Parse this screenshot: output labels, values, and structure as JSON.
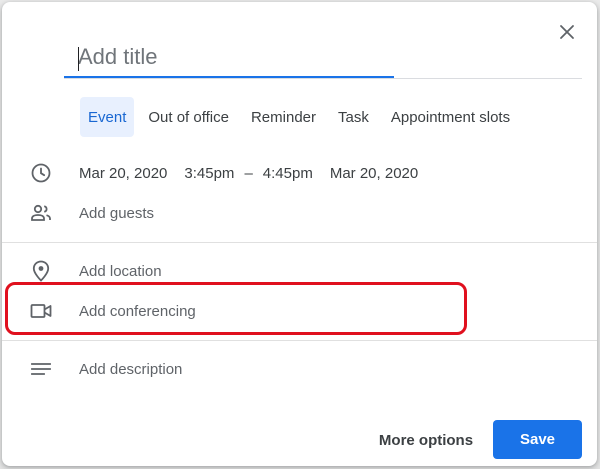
{
  "dialog": {
    "title": {
      "placeholder": "Add title",
      "value": ""
    },
    "tabs": [
      {
        "label": "Event",
        "active": true
      },
      {
        "label": "Out of office",
        "active": false
      },
      {
        "label": "Reminder",
        "active": false
      },
      {
        "label": "Task",
        "active": false
      },
      {
        "label": "Appointment slots",
        "active": false
      }
    ],
    "datetime": {
      "start_date": "Mar 20, 2020",
      "start_time": "3:45pm",
      "separator": "–",
      "end_time": "4:45pm",
      "end_date": "Mar 20, 2020"
    },
    "rows": {
      "guests": "Add guests",
      "location": "Add location",
      "conferencing": "Add conferencing",
      "description": "Add description"
    },
    "footer": {
      "more_options": "More options",
      "save": "Save"
    },
    "icons": {
      "close": "close-icon",
      "clock": "clock-icon",
      "guests": "people-icon",
      "location": "location-pin-icon",
      "conferencing": "video-camera-icon",
      "description": "description-lines-icon"
    },
    "colors": {
      "accent": "#1a73e8",
      "active_tab_bg": "#e8f0fe",
      "highlight": "#e0101e"
    }
  }
}
